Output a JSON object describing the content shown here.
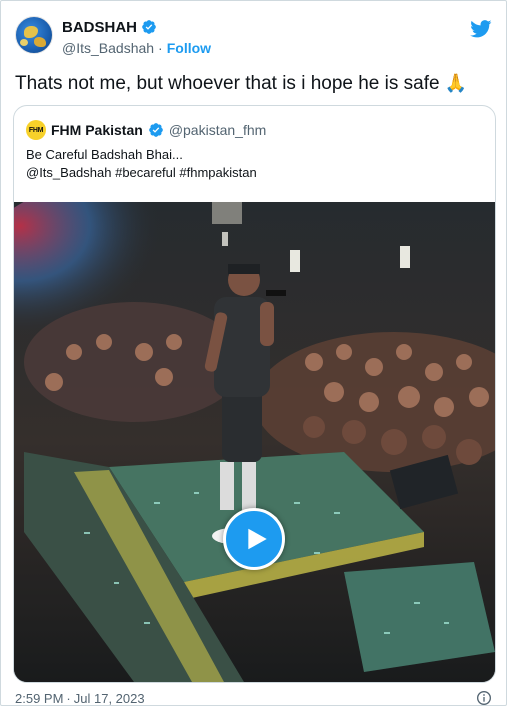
{
  "author": {
    "name": "BADSHAH",
    "handle": "@Its_Badshah",
    "separator": "·",
    "follow_label": "Follow"
  },
  "tweet": {
    "text": "Thats not me, but whoever that is i hope he is safe",
    "emoji": "🙏"
  },
  "quote": {
    "logo_text": "FHM",
    "name": "FHM Pakistan",
    "handle": "@pakistan_fhm",
    "lines": [
      "Be Careful Badshah Bhai...",
      "@Its_Badshah #becareful #fhmpakistan"
    ]
  },
  "footer": {
    "time": "2:59 PM",
    "separator": "·",
    "date": "Jul 17, 2023"
  },
  "icons": {
    "verified": "verified-badge-icon",
    "brand": "twitter-bird-icon",
    "play": "play-icon",
    "info": "info-icon"
  },
  "colors": {
    "accent": "#1d9bf0",
    "text": "#0f1419",
    "secondary": "#536471",
    "border": "#cfd9de"
  }
}
